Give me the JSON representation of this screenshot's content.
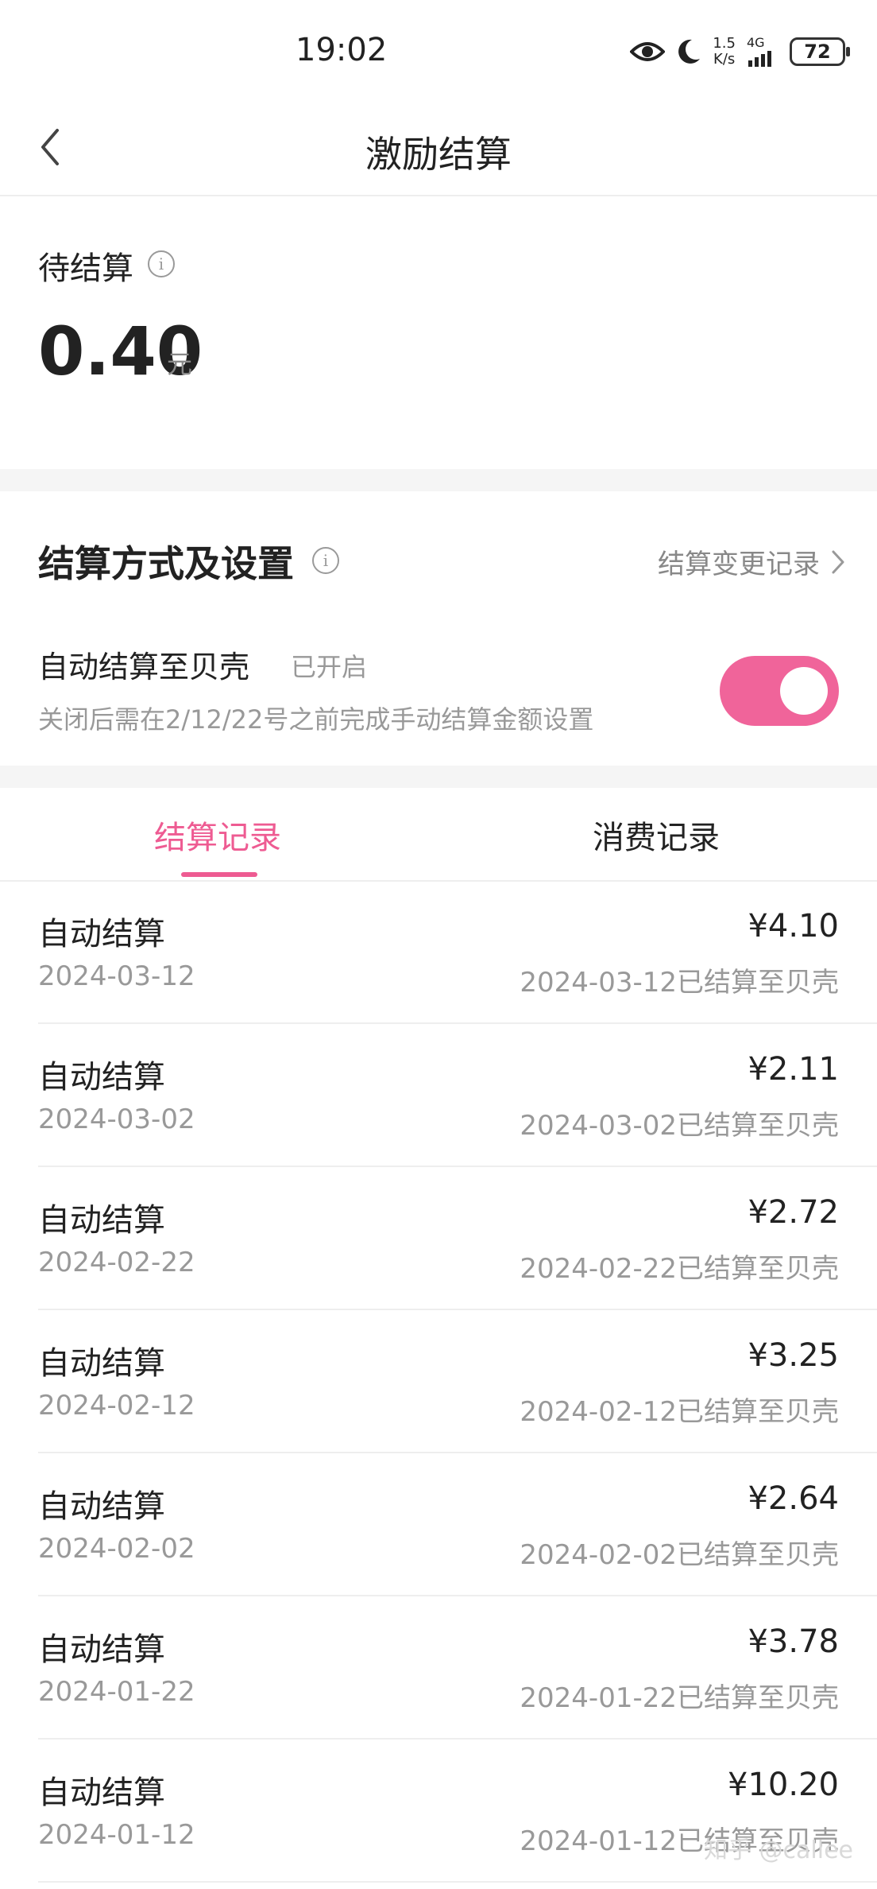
{
  "status_bar": {
    "time": "19:02",
    "speed_value": "1.5",
    "speed_unit": "K/s",
    "network": "4G",
    "battery": "72",
    "icons": [
      "eye-icon",
      "moon-icon",
      "signal-icon"
    ]
  },
  "nav": {
    "title": "激励结算"
  },
  "pending": {
    "label": "待结算",
    "amount": "0.40",
    "unit": "元"
  },
  "settings": {
    "title": "结算方式及设置",
    "change_log": "结算变更记录",
    "auto_label": "自动结算至贝壳",
    "auto_status": "已开启",
    "auto_desc": "关闭后需在2/12/22号之前完成手动结算金额设置",
    "toggle_on": true,
    "accent_color": "#f0649a"
  },
  "tabs": [
    {
      "label": "结算记录",
      "active": true
    },
    {
      "label": "消费记录",
      "active": false
    }
  ],
  "records": [
    {
      "title": "自动结算",
      "date": "2024-03-12",
      "amount": "¥4.10",
      "note": "2024-03-12已结算至贝壳"
    },
    {
      "title": "自动结算",
      "date": "2024-03-02",
      "amount": "¥2.11",
      "note": "2024-03-02已结算至贝壳"
    },
    {
      "title": "自动结算",
      "date": "2024-02-22",
      "amount": "¥2.72",
      "note": "2024-02-22已结算至贝壳"
    },
    {
      "title": "自动结算",
      "date": "2024-02-12",
      "amount": "¥3.25",
      "note": "2024-02-12已结算至贝壳"
    },
    {
      "title": "自动结算",
      "date": "2024-02-02",
      "amount": "¥2.64",
      "note": "2024-02-02已结算至贝壳"
    },
    {
      "title": "自动结算",
      "date": "2024-01-22",
      "amount": "¥3.78",
      "note": "2024-01-22已结算至贝壳"
    },
    {
      "title": "自动结算",
      "date": "2024-01-12",
      "amount": "¥10.20",
      "note": "2024-01-12已结算至贝壳"
    }
  ],
  "watermark": "知乎 @callee"
}
